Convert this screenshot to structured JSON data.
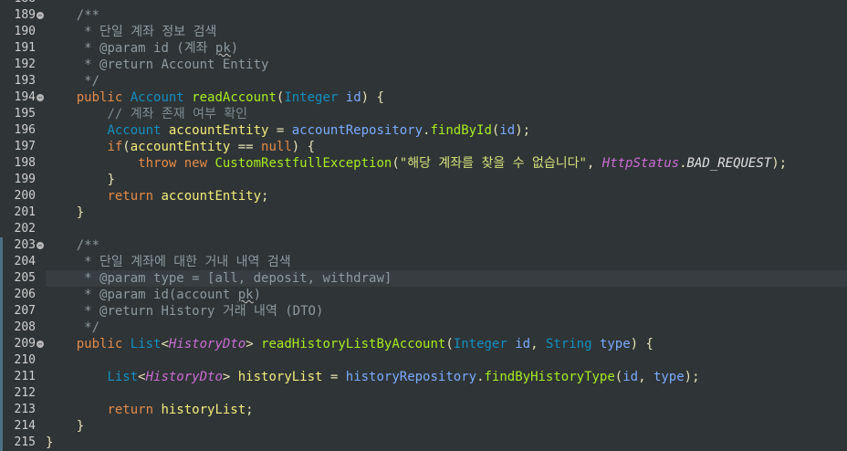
{
  "editor": {
    "partial_top_line": "188",
    "lines": [
      {
        "num": "189",
        "fold": true,
        "tokens": [
          {
            "t": "    "
          },
          {
            "c": "jd",
            "t": "/**"
          }
        ]
      },
      {
        "num": "190",
        "fold": false,
        "tokens": [
          {
            "t": "     "
          },
          {
            "c": "jd",
            "t": "* 단일 계좌 정보 검색"
          }
        ]
      },
      {
        "num": "191",
        "fold": false,
        "tokens": [
          {
            "t": "     "
          },
          {
            "c": "jd",
            "t": "* @param id (계좌 "
          },
          {
            "c": "jd sq",
            "t": "pk"
          },
          {
            "c": "jd",
            "t": ")"
          }
        ]
      },
      {
        "num": "192",
        "fold": false,
        "tokens": [
          {
            "t": "     "
          },
          {
            "c": "jd",
            "t": "* @return Account Entity"
          }
        ]
      },
      {
        "num": "193",
        "fold": false,
        "tokens": [
          {
            "t": "     "
          },
          {
            "c": "jd",
            "t": "*/"
          }
        ]
      },
      {
        "num": "194",
        "fold": true,
        "tokens": [
          {
            "t": "    "
          },
          {
            "c": "kw",
            "t": "public "
          },
          {
            "c": "ty",
            "t": "Account "
          },
          {
            "c": "fn",
            "t": "readAccount"
          },
          {
            "c": "op",
            "t": "("
          },
          {
            "c": "ty",
            "t": "Integer "
          },
          {
            "c": "pa",
            "t": "id"
          },
          {
            "c": "op",
            "t": ") {"
          }
        ]
      },
      {
        "num": "195",
        "fold": false,
        "tokens": [
          {
            "t": "        "
          },
          {
            "c": "cm",
            "t": "// 계좌 존재 여부 확인"
          }
        ]
      },
      {
        "num": "196",
        "fold": false,
        "tokens": [
          {
            "t": "        "
          },
          {
            "c": "ty",
            "t": "Account "
          },
          {
            "c": "lv",
            "t": "accountEntity"
          },
          {
            "c": "op",
            "t": " = "
          },
          {
            "c": "pa",
            "t": "accountRepository"
          },
          {
            "c": "op",
            "t": "."
          },
          {
            "c": "fn",
            "t": "findById"
          },
          {
            "c": "op",
            "t": "("
          },
          {
            "c": "pa",
            "t": "id"
          },
          {
            "c": "op",
            "t": ");"
          }
        ]
      },
      {
        "num": "197",
        "fold": false,
        "tokens": [
          {
            "t": "        "
          },
          {
            "c": "kw",
            "t": "if"
          },
          {
            "c": "op",
            "t": "("
          },
          {
            "c": "lv",
            "t": "accountEntity"
          },
          {
            "c": "op",
            "t": " == "
          },
          {
            "c": "kw",
            "t": "null"
          },
          {
            "c": "op",
            "t": ") {"
          }
        ]
      },
      {
        "num": "198",
        "fold": false,
        "tokens": [
          {
            "t": "            "
          },
          {
            "c": "kw",
            "t": "throw new "
          },
          {
            "c": "fn",
            "t": "CustomRestfullException"
          },
          {
            "c": "op",
            "t": "("
          },
          {
            "c": "st",
            "t": "\"해당 계좌를 찾을 수 없습니다\""
          },
          {
            "c": "op",
            "t": ", "
          },
          {
            "c": "it",
            "t": "HttpStatus"
          },
          {
            "c": "op",
            "t": "."
          },
          {
            "c": "sf",
            "t": "BAD_REQUEST"
          },
          {
            "c": "op",
            "t": ");"
          }
        ]
      },
      {
        "num": "199",
        "fold": false,
        "tokens": [
          {
            "t": "        "
          },
          {
            "c": "op",
            "t": "}"
          }
        ]
      },
      {
        "num": "200",
        "fold": false,
        "tokens": [
          {
            "t": "        "
          },
          {
            "c": "kw",
            "t": "return "
          },
          {
            "c": "lv",
            "t": "accountEntity"
          },
          {
            "c": "op",
            "t": ";"
          }
        ]
      },
      {
        "num": "201",
        "fold": false,
        "tokens": [
          {
            "t": "    "
          },
          {
            "c": "op",
            "t": "}"
          }
        ]
      },
      {
        "num": "202",
        "fold": false,
        "tokens": []
      },
      {
        "num": "203",
        "fold": true,
        "tokens": [
          {
            "t": "    "
          },
          {
            "c": "jd",
            "t": "/**"
          }
        ]
      },
      {
        "num": "204",
        "fold": false,
        "tokens": [
          {
            "t": "     "
          },
          {
            "c": "jd",
            "t": "* 단일 계좌에 대한 거내 내역 검색"
          }
        ]
      },
      {
        "num": "205",
        "fold": false,
        "current": true,
        "tokens": [
          {
            "t": "     "
          },
          {
            "c": "jd",
            "t": "* @param type = [all, deposit, withdraw]"
          }
        ]
      },
      {
        "num": "206",
        "fold": false,
        "tokens": [
          {
            "t": "     "
          },
          {
            "c": "jd",
            "t": "* @param id(account "
          },
          {
            "c": "jd sq",
            "t": "pk"
          },
          {
            "c": "jd",
            "t": ")"
          }
        ]
      },
      {
        "num": "207",
        "fold": false,
        "tokens": [
          {
            "t": "     "
          },
          {
            "c": "jd",
            "t": "* @return History 거래 내역 (DTO)"
          }
        ]
      },
      {
        "num": "208",
        "fold": false,
        "tokens": [
          {
            "t": "     "
          },
          {
            "c": "jd",
            "t": "*/"
          }
        ]
      },
      {
        "num": "209",
        "fold": true,
        "tokens": [
          {
            "t": "    "
          },
          {
            "c": "kw",
            "t": "public "
          },
          {
            "c": "ty",
            "t": "List"
          },
          {
            "c": "op",
            "t": "<"
          },
          {
            "c": "it",
            "t": "HistoryDto"
          },
          {
            "c": "op",
            "t": "> "
          },
          {
            "c": "fn",
            "t": "readHistoryListByAccount"
          },
          {
            "c": "op",
            "t": "("
          },
          {
            "c": "ty",
            "t": "Integer "
          },
          {
            "c": "pa",
            "t": "id"
          },
          {
            "c": "op",
            "t": ", "
          },
          {
            "c": "ty",
            "t": "String "
          },
          {
            "c": "pa",
            "t": "type"
          },
          {
            "c": "op",
            "t": ") {"
          }
        ]
      },
      {
        "num": "210",
        "fold": false,
        "tokens": []
      },
      {
        "num": "211",
        "fold": false,
        "tokens": [
          {
            "t": "        "
          },
          {
            "c": "ty",
            "t": "List"
          },
          {
            "c": "op",
            "t": "<"
          },
          {
            "c": "it",
            "t": "HistoryDto"
          },
          {
            "c": "op",
            "t": "> "
          },
          {
            "c": "lv",
            "t": "historyList"
          },
          {
            "c": "op",
            "t": " = "
          },
          {
            "c": "pa",
            "t": "historyRepository"
          },
          {
            "c": "op",
            "t": "."
          },
          {
            "c": "fn",
            "t": "findByHistoryType"
          },
          {
            "c": "op",
            "t": "("
          },
          {
            "c": "pa",
            "t": "id"
          },
          {
            "c": "op",
            "t": ", "
          },
          {
            "c": "pa",
            "t": "type"
          },
          {
            "c": "op",
            "t": ");"
          }
        ]
      },
      {
        "num": "212",
        "fold": false,
        "tokens": []
      },
      {
        "num": "213",
        "fold": false,
        "tokens": [
          {
            "t": "        "
          },
          {
            "c": "kw",
            "t": "return "
          },
          {
            "c": "lv",
            "t": "historyList"
          },
          {
            "c": "op",
            "t": ";"
          }
        ]
      },
      {
        "num": "214",
        "fold": false,
        "tokens": [
          {
            "t": "    "
          },
          {
            "c": "op",
            "t": "}"
          }
        ]
      },
      {
        "num": "215",
        "fold": false,
        "tokens": [
          {
            "c": "op",
            "t": "}"
          }
        ]
      }
    ]
  }
}
